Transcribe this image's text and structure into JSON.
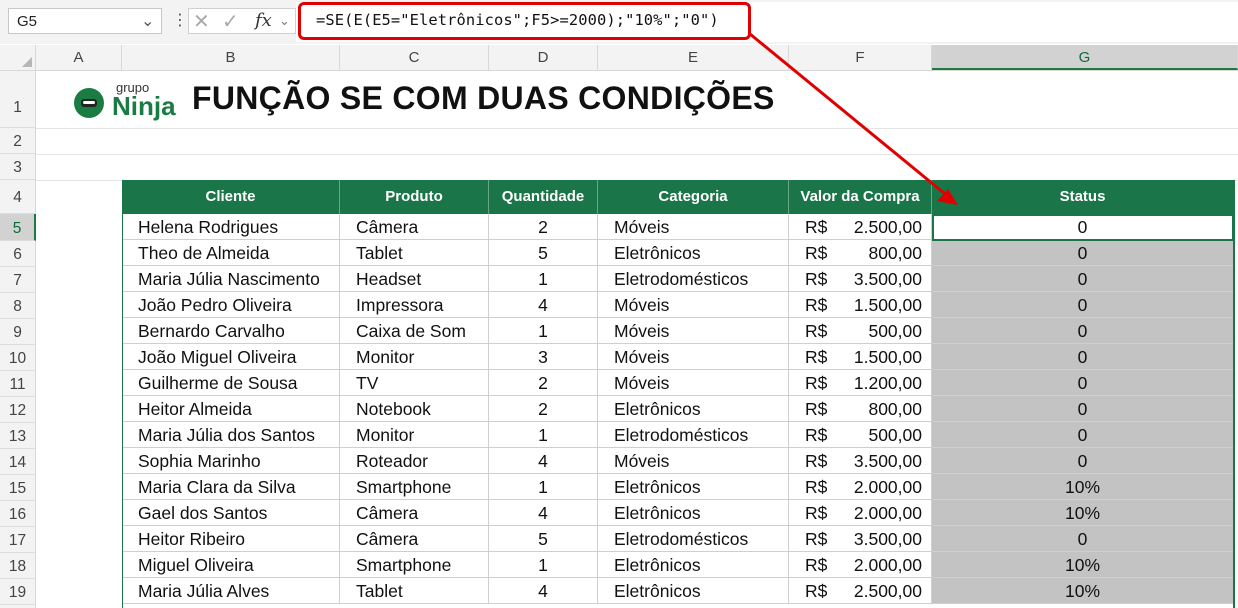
{
  "formula_bar": {
    "name_box": "G5",
    "formula": "=SE(E(E5=\"Eletrônicos\";F5>=2000);\"10%\";\"0\")",
    "fx_label": "fx",
    "cancel_glyph": "✕",
    "enter_glyph": "✓"
  },
  "columns": [
    "A",
    "B",
    "C",
    "D",
    "E",
    "F",
    "G"
  ],
  "selected_column": "G",
  "rows": [
    "1",
    "2",
    "3",
    "4",
    "5",
    "6",
    "7",
    "8",
    "9",
    "10",
    "11",
    "12",
    "13",
    "14",
    "15",
    "16",
    "17",
    "18",
    "19"
  ],
  "selected_row": "5",
  "banner": {
    "logo_small": "grupo",
    "logo_big": "Ninja",
    "title": "FUNÇÃO SE COM DUAS CONDIÇÕES"
  },
  "table": {
    "headers": [
      "Cliente",
      "Produto",
      "Quantidade",
      "Categoria",
      "Valor da Compra",
      "Status"
    ],
    "rows": [
      {
        "cliente": "Helena Rodrigues",
        "produto": "Câmera",
        "qtd": "2",
        "categoria": "Móveis",
        "moeda": "R$",
        "valor": "2.500,00",
        "status": "0"
      },
      {
        "cliente": "Theo de Almeida",
        "produto": "Tablet",
        "qtd": "5",
        "categoria": "Eletrônicos",
        "moeda": "R$",
        "valor": "800,00",
        "status": "0"
      },
      {
        "cliente": "Maria Júlia Nascimento",
        "produto": "Headset",
        "qtd": "1",
        "categoria": "Eletrodomésticos",
        "moeda": "R$",
        "valor": "3.500,00",
        "status": "0"
      },
      {
        "cliente": "João Pedro Oliveira",
        "produto": "Impressora",
        "qtd": "4",
        "categoria": "Móveis",
        "moeda": "R$",
        "valor": "1.500,00",
        "status": "0"
      },
      {
        "cliente": "Bernardo Carvalho",
        "produto": "Caixa de Som",
        "qtd": "1",
        "categoria": "Móveis",
        "moeda": "R$",
        "valor": "500,00",
        "status": "0"
      },
      {
        "cliente": "João Miguel Oliveira",
        "produto": "Monitor",
        "qtd": "3",
        "categoria": "Móveis",
        "moeda": "R$",
        "valor": "1.500,00",
        "status": "0"
      },
      {
        "cliente": "Guilherme de Sousa",
        "produto": "TV",
        "qtd": "2",
        "categoria": "Móveis",
        "moeda": "R$",
        "valor": "1.200,00",
        "status": "0"
      },
      {
        "cliente": "Heitor Almeida",
        "produto": "Notebook",
        "qtd": "2",
        "categoria": "Eletrônicos",
        "moeda": "R$",
        "valor": "800,00",
        "status": "0"
      },
      {
        "cliente": "Maria Júlia dos Santos",
        "produto": "Monitor",
        "qtd": "1",
        "categoria": "Eletrodomésticos",
        "moeda": "R$",
        "valor": "500,00",
        "status": "0"
      },
      {
        "cliente": "Sophia Marinho",
        "produto": "Roteador",
        "qtd": "4",
        "categoria": "Móveis",
        "moeda": "R$",
        "valor": "3.500,00",
        "status": "0"
      },
      {
        "cliente": "Maria Clara da Silva",
        "produto": "Smartphone",
        "qtd": "1",
        "categoria": "Eletrônicos",
        "moeda": "R$",
        "valor": "2.000,00",
        "status": "10%"
      },
      {
        "cliente": "Gael dos Santos",
        "produto": "Câmera",
        "qtd": "4",
        "categoria": "Eletrônicos",
        "moeda": "R$",
        "valor": "2.000,00",
        "status": "10%"
      },
      {
        "cliente": "Heitor Ribeiro",
        "produto": "Câmera",
        "qtd": "5",
        "categoria": "Eletrodomésticos",
        "moeda": "R$",
        "valor": "3.500,00",
        "status": "0"
      },
      {
        "cliente": "Miguel Oliveira",
        "produto": "Smartphone",
        "qtd": "1",
        "categoria": "Eletrônicos",
        "moeda": "R$",
        "valor": "2.000,00",
        "status": "10%"
      },
      {
        "cliente": "Maria Júlia Alves",
        "produto": "Tablet",
        "qtd": "4",
        "categoria": "Eletrônicos",
        "moeda": "R$",
        "valor": "2.500,00",
        "status": "10%"
      }
    ]
  },
  "colors": {
    "header_green": "#1a7548",
    "highlight_red": "#e00000",
    "status_fill": "#c3c3c3"
  }
}
